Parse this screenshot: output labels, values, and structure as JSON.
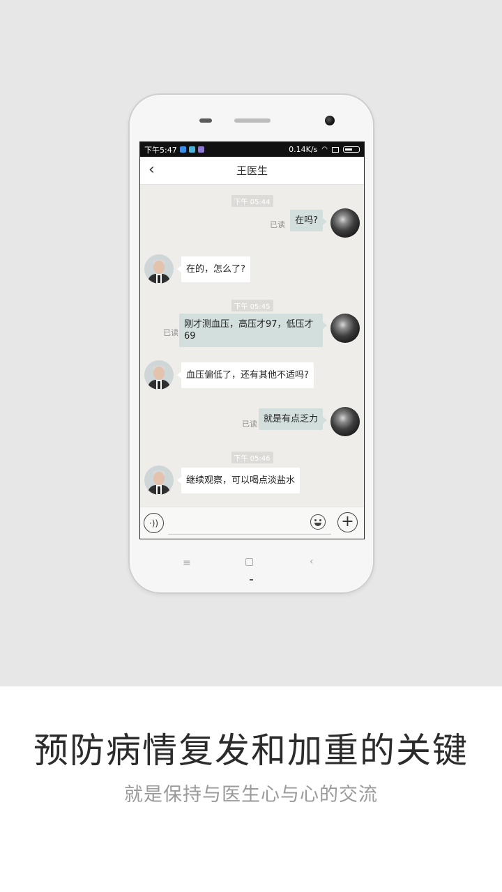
{
  "status_bar": {
    "time": "下午5:47",
    "network_speed": "0.14K/s",
    "icons": [
      "shield-icon",
      "app-icon",
      "notification-icon",
      "wifi-icon",
      "sim-icon",
      "battery-icon"
    ]
  },
  "nav": {
    "back_icon": "‹",
    "title": "王医生"
  },
  "messages": [
    {
      "type": "time",
      "text": "下午 05:44"
    },
    {
      "type": "me",
      "text": "在吗?",
      "status": "已读"
    },
    {
      "type": "doctor",
      "text": "在的，怎么了?"
    },
    {
      "type": "time",
      "text": "下午 05:45"
    },
    {
      "type": "me",
      "text": "刚才测血压，高压才97，低压才69",
      "status": "已读"
    },
    {
      "type": "doctor",
      "text": "血压偏低了，还有其他不适吗?"
    },
    {
      "type": "me",
      "text": "就是有点乏力",
      "status": "已读"
    },
    {
      "type": "time",
      "text": "下午 05:46"
    },
    {
      "type": "doctor",
      "text": "继续观察，可以喝点淡盐水"
    }
  ],
  "input_bar": {
    "voice_icon": "·))",
    "plus_icon": "+",
    "placeholder": ""
  },
  "promo": {
    "headline": "预防病情复发和加重的关键",
    "subline": "就是保持与医生心与心的交流"
  },
  "colors": {
    "chat_background": "#eeede9",
    "my_bubble": "#d3dfdd",
    "doctor_bubble": "#ffffff",
    "page_background": "#e7e7e7"
  }
}
